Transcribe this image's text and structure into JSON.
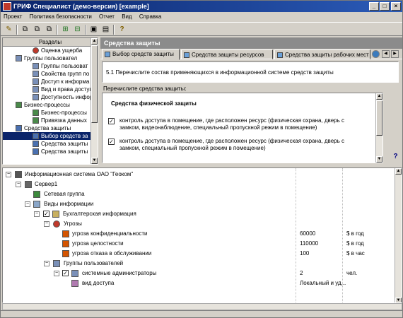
{
  "window": {
    "title": "ГРИФ Специалист (демо-версия) [example]"
  },
  "menu": [
    "Проект",
    "Политика безопасности",
    "Отчет",
    "Вид",
    "Справка"
  ],
  "left_panel": {
    "header": "Разделы",
    "items": [
      "Оценка ущерба",
      "Группы пользовател",
      "Группы пользоват",
      "Свойства групп по",
      "Доступ к информа",
      "Вид и права доступ",
      "Доступность инфор",
      "Бизнес-процессы",
      "Бизнес-процессы",
      "Привязка данных",
      "Средства защиты",
      "Выбор средств за",
      "Средства защиты",
      "Средства защиты"
    ]
  },
  "right_panel": {
    "title": "Средства защиты",
    "tabs": [
      "Выбор средств защиты",
      "Средства защиты ресурсов",
      "Средства защиты рабочих мест"
    ],
    "question": "5.1 Перечислите состав применяющихся в информационной системе средств защиты",
    "list_label": "Перечислите средства защиты:",
    "list_header": "Средства физической защиты",
    "list_items": [
      {
        "checked": true,
        "text": "контроль доступа в помещение, где расположен ресурс (физическая охрана, дверь с замком, видеонаблюдение, специальный пропускной режим в помещение)"
      },
      {
        "checked": true,
        "text": "контроль доступа в помещение, где расположен ресурс (физическая охрана, дверь с замком, специальный пропускной режим в помещение)"
      }
    ],
    "help": "?"
  },
  "bottom_tree": {
    "rows": [
      {
        "label": "Информационная система ОАО \"Геоком\"",
        "c1": "",
        "c2": ""
      },
      {
        "label": "Сервер1",
        "c1": "",
        "c2": ""
      },
      {
        "label": "Сетевая группа",
        "c1": "",
        "c2": ""
      },
      {
        "label": "Виды информации",
        "c1": "",
        "c2": ""
      },
      {
        "label": "Бухгалтерская информация",
        "c1": "",
        "c2": ""
      },
      {
        "label": "Угрозы",
        "c1": "",
        "c2": ""
      },
      {
        "label": "угроза конфиденциальности",
        "c1": "60000",
        "c2": "$ в год"
      },
      {
        "label": "угроза целостности",
        "c1": "110000",
        "c2": "$ в год"
      },
      {
        "label": "угроза отказа в обслуживании",
        "c1": "100",
        "c2": "$ в час"
      },
      {
        "label": "Группы пользователей",
        "c1": "",
        "c2": ""
      },
      {
        "label": "системные администраторы",
        "c1": "2",
        "c2": "чел."
      },
      {
        "label": "вид доступа",
        "c1": "Локальный и уд...",
        "c2": ""
      }
    ]
  }
}
